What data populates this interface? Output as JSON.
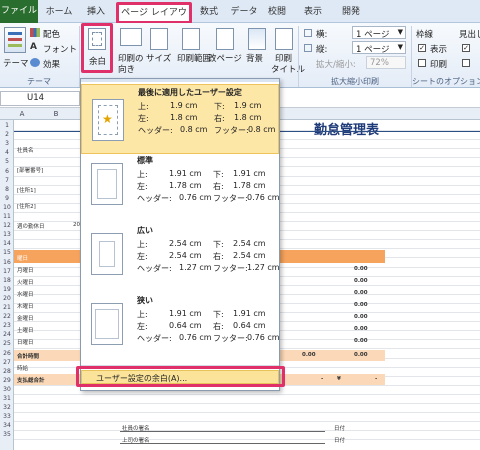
{
  "tabs": [
    "ファイル",
    "ホーム",
    "挿入",
    "ページ レイアウト",
    "数式",
    "データ",
    "校閲",
    "表示",
    "開発"
  ],
  "ribbon": {
    "theme": {
      "themes": "テーマ",
      "colors": "配色",
      "fonts": "フォント",
      "effects": "効果",
      "group": "テーマ"
    },
    "page_setup": {
      "margins": "余白",
      "orientation1": "印刷の",
      "orientation2": "向き",
      "size": "サイズ",
      "print_area1": "印刷範囲",
      "breaks": "改ページ",
      "background": "背景",
      "print_titles1": "印刷",
      "print_titles2": "タイトル"
    },
    "scale": {
      "width_label": "横:",
      "width_value": "1 ページ",
      "height_label": "縦:",
      "height_value": "1 ページ",
      "zoom_label": "拡大/縮小:",
      "zoom_value": "72%",
      "group": "拡大縮小印刷"
    },
    "sheet_options": {
      "gridlines": "枠線",
      "headings": "見出し",
      "view": "表示",
      "print": "印刷",
      "group": "シートのオプション"
    }
  },
  "formula": {
    "namebox": "U14"
  },
  "columns": [
    "B",
    "C",
    "D"
  ],
  "rows": [
    "1",
    "2",
    "3",
    "4",
    "5",
    "6",
    "7",
    "8",
    "9",
    "10",
    "11",
    "12",
    "13",
    "14",
    "15",
    "16",
    "17",
    "18",
    "19",
    "20",
    "21",
    "22",
    "23",
    "24",
    "25",
    "26",
    "27",
    "28",
    "29",
    "30",
    "31",
    "32",
    "33",
    "34",
    "35"
  ],
  "sheet": {
    "title": "勤怠管理表",
    "left_labels": [
      "社員名",
      "[部署番号]",
      "[住所1]",
      "[住所2]",
      "週の勤休日"
    ],
    "year_cell": "200",
    "header_left": "曜日",
    "row_labels": [
      "月曜日",
      "火曜日",
      "水曜日",
      "木曜日",
      "金曜日",
      "土曜日",
      "日曜日"
    ],
    "total_label": "合計時間",
    "rate_label": "時給",
    "pay_label": "支払総合計",
    "zero": "0.00",
    "yen_dash": "-",
    "yen": "¥",
    "sign1": "社員の署名",
    "sign2": "上司の署名",
    "date1": "日付",
    "date2": "日付"
  },
  "dropdown": {
    "options": [
      {
        "name": "最後に適用したユーザー設定",
        "top_label": "上:",
        "top": "1.9 cm",
        "bottom_label": "下:",
        "bottom": "1.9 cm",
        "left_label": "左:",
        "left": "1.8 cm",
        "right_label": "右:",
        "right": "1.8 cm",
        "header_label": "ヘッダー:",
        "header": "0.8 cm",
        "footer_label": "フッター:",
        "footer": "0.8 cm"
      },
      {
        "name": "標準",
        "top_label": "上:",
        "top": "1.91 cm",
        "bottom_label": "下:",
        "bottom": "1.91 cm",
        "left_label": "左:",
        "left": "1.78 cm",
        "right_label": "右:",
        "right": "1.78 cm",
        "header_label": "ヘッダー:",
        "header": "0.76 cm",
        "footer_label": "フッター:",
        "footer": "0.76 cm"
      },
      {
        "name": "広い",
        "top_label": "上:",
        "top": "2.54 cm",
        "bottom_label": "下:",
        "bottom": "2.54 cm",
        "left_label": "左:",
        "left": "2.54 cm",
        "right_label": "右:",
        "right": "2.54 cm",
        "header_label": "ヘッダー:",
        "header": "1.27 cm",
        "footer_label": "フッター:",
        "footer": "1.27 cm"
      },
      {
        "name": "狭い",
        "top_label": "上:",
        "top": "1.91 cm",
        "bottom_label": "下:",
        "bottom": "1.91 cm",
        "left_label": "左:",
        "left": "0.64 cm",
        "right_label": "右:",
        "right": "0.64 cm",
        "header_label": "ヘッダー:",
        "header": "0.76 cm",
        "footer_label": "フッター:",
        "footer": "0.76 cm"
      }
    ],
    "custom": "ユーザー設定の余白(A)..."
  },
  "colors": {
    "accent_highlight": "#e0306a",
    "file_tab": "#2a6e2f",
    "table_orange": "#f6a35d"
  }
}
